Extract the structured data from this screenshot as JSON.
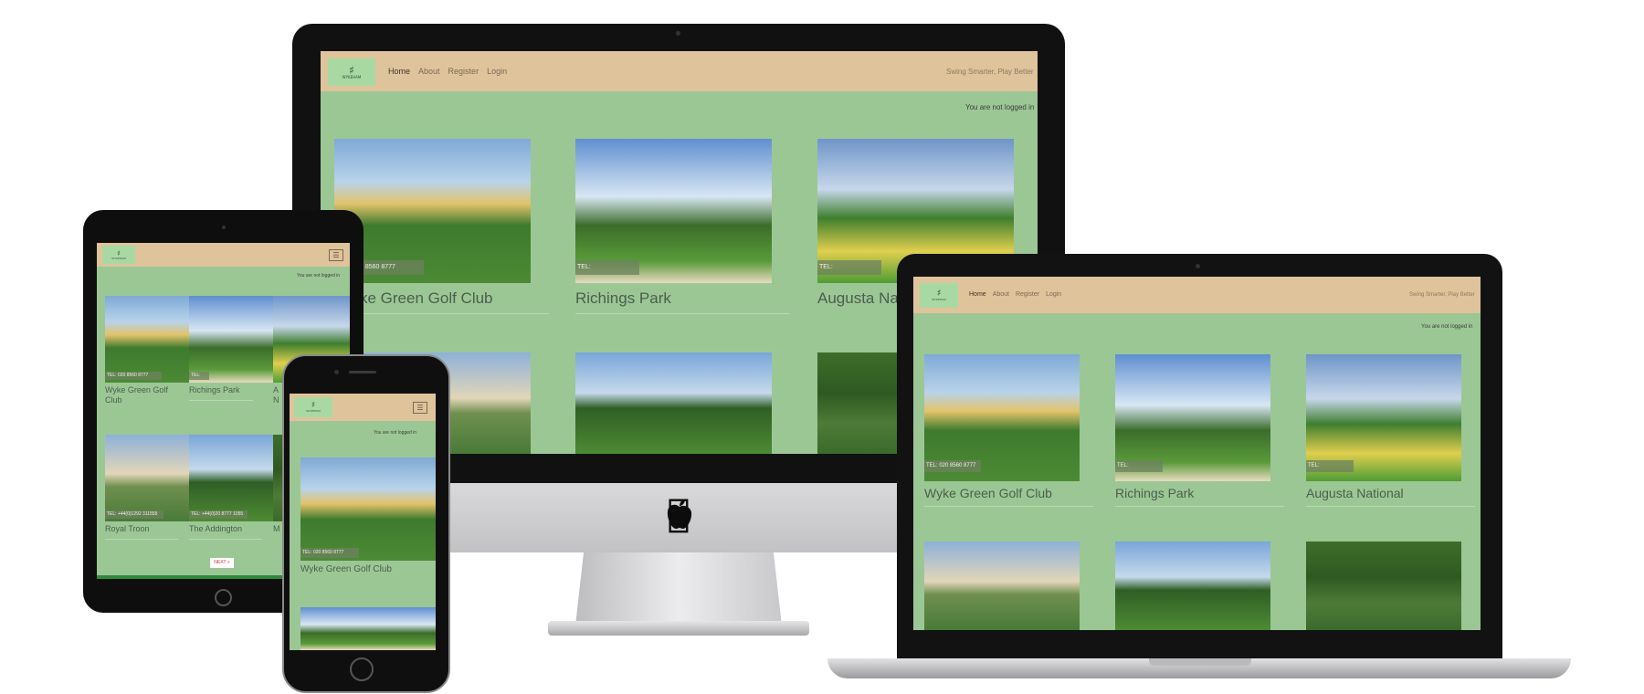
{
  "site": {
    "logo_text": "WYKEHAM",
    "nav": [
      "Home",
      "About",
      "Register",
      "Login"
    ],
    "tagline": "Swing Smarter, Play Better",
    "not_logged_in": "You are not logged in",
    "next_button": "NEXT »"
  },
  "courses": [
    {
      "name": "Wyke Green Golf Club",
      "tel": "TEL: 020 8560 8777"
    },
    {
      "name": "Richings Park",
      "tel": "TEL:"
    },
    {
      "name": "Augusta National",
      "tel": "TEL:"
    },
    {
      "name": "Royal Troon",
      "tel": "TEL: +44(0)1292 311555"
    },
    {
      "name": "The Addington",
      "tel": "TEL: +44(0)20 8777 1055"
    },
    {
      "name": "Mere",
      "tel": "TEL:"
    }
  ],
  "imac_courses": [
    {
      "name": "Wyke Green Golf Club",
      "tel": "TEL: 020 8560 8777"
    },
    {
      "name": "Richings Park",
      "tel": "TEL:"
    },
    {
      "name": "Augusta National",
      "tel": "TEL:"
    }
  ],
  "imac_name0": "ke Green Golf Club",
  "imac_tel0": "0 8560 8777",
  "imac_name2": "Augusta Na",
  "tablet_name2": "A N",
  "tablet_name5": "M",
  "icons": {
    "menu": "hamburger-icon",
    "apple": "apple-logo-icon"
  }
}
